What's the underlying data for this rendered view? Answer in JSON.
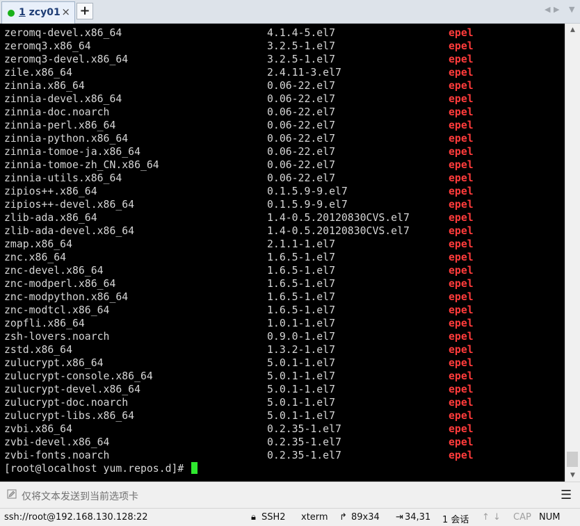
{
  "tab": {
    "number": "1",
    "title": "zcy01",
    "close": "×",
    "add": "+"
  },
  "terminal": {
    "packages": [
      {
        "name": "zeromq-devel.x86_64",
        "version": "4.1.4-5.el7",
        "repo": "epel"
      },
      {
        "name": "zeromq3.x86_64",
        "version": "3.2.5-1.el7",
        "repo": "epel"
      },
      {
        "name": "zeromq3-devel.x86_64",
        "version": "3.2.5-1.el7",
        "repo": "epel"
      },
      {
        "name": "zile.x86_64",
        "version": "2.4.11-3.el7",
        "repo": "epel"
      },
      {
        "name": "zinnia.x86_64",
        "version": "0.06-22.el7",
        "repo": "epel"
      },
      {
        "name": "zinnia-devel.x86_64",
        "version": "0.06-22.el7",
        "repo": "epel"
      },
      {
        "name": "zinnia-doc.noarch",
        "version": "0.06-22.el7",
        "repo": "epel"
      },
      {
        "name": "zinnia-perl.x86_64",
        "version": "0.06-22.el7",
        "repo": "epel"
      },
      {
        "name": "zinnia-python.x86_64",
        "version": "0.06-22.el7",
        "repo": "epel"
      },
      {
        "name": "zinnia-tomoe-ja.x86_64",
        "version": "0.06-22.el7",
        "repo": "epel"
      },
      {
        "name": "zinnia-tomoe-zh_CN.x86_64",
        "version": "0.06-22.el7",
        "repo": "epel"
      },
      {
        "name": "zinnia-utils.x86_64",
        "version": "0.06-22.el7",
        "repo": "epel"
      },
      {
        "name": "zipios++.x86_64",
        "version": "0.1.5.9-9.el7",
        "repo": "epel"
      },
      {
        "name": "zipios++-devel.x86_64",
        "version": "0.1.5.9-9.el7",
        "repo": "epel"
      },
      {
        "name": "zlib-ada.x86_64",
        "version": "1.4-0.5.20120830CVS.el7",
        "repo": "epel"
      },
      {
        "name": "zlib-ada-devel.x86_64",
        "version": "1.4-0.5.20120830CVS.el7",
        "repo": "epel"
      },
      {
        "name": "zmap.x86_64",
        "version": "2.1.1-1.el7",
        "repo": "epel"
      },
      {
        "name": "znc.x86_64",
        "version": "1.6.5-1.el7",
        "repo": "epel"
      },
      {
        "name": "znc-devel.x86_64",
        "version": "1.6.5-1.el7",
        "repo": "epel"
      },
      {
        "name": "znc-modperl.x86_64",
        "version": "1.6.5-1.el7",
        "repo": "epel"
      },
      {
        "name": "znc-modpython.x86_64",
        "version": "1.6.5-1.el7",
        "repo": "epel"
      },
      {
        "name": "znc-modtcl.x86_64",
        "version": "1.6.5-1.el7",
        "repo": "epel"
      },
      {
        "name": "zopfli.x86_64",
        "version": "1.0.1-1.el7",
        "repo": "epel"
      },
      {
        "name": "zsh-lovers.noarch",
        "version": "0.9.0-1.el7",
        "repo": "epel"
      },
      {
        "name": "zstd.x86_64",
        "version": "1.3.2-1.el7",
        "repo": "epel"
      },
      {
        "name": "zulucrypt.x86_64",
        "version": "5.0.1-1.el7",
        "repo": "epel"
      },
      {
        "name": "zulucrypt-console.x86_64",
        "version": "5.0.1-1.el7",
        "repo": "epel"
      },
      {
        "name": "zulucrypt-devel.x86_64",
        "version": "5.0.1-1.el7",
        "repo": "epel"
      },
      {
        "name": "zulucrypt-doc.noarch",
        "version": "5.0.1-1.el7",
        "repo": "epel"
      },
      {
        "name": "zulucrypt-libs.x86_64",
        "version": "5.0.1-1.el7",
        "repo": "epel"
      },
      {
        "name": "zvbi.x86_64",
        "version": "0.2.35-1.el7",
        "repo": "epel"
      },
      {
        "name": "zvbi-devel.x86_64",
        "version": "0.2.35-1.el7",
        "repo": "epel"
      },
      {
        "name": "zvbi-fonts.noarch",
        "version": "0.2.35-1.el7",
        "repo": "epel"
      }
    ],
    "prompt": "[root@localhost yum.repos.d]# "
  },
  "sendbar": {
    "placeholder": "仅将文本发送到当前选项卡",
    "menu": "☰"
  },
  "statusbar": {
    "connection": "ssh://root@192.168.130.128:22",
    "protocol": "SSH2",
    "terminal_type": "xterm",
    "size": "89x34",
    "cursor_pos": "34,31",
    "sessions": "1 会话",
    "caps": "CAP",
    "num": "NUM"
  },
  "colors": {
    "repo": "#ff3b3b",
    "cursor": "#2fe82f",
    "active_dot": "#19b119"
  },
  "icons": [
    "close-icon",
    "add-tab-icon",
    "pencil-icon",
    "menu-icon",
    "lock-icon",
    "resize-icon",
    "arrow-up-icon",
    "arrow-down-icon"
  ]
}
